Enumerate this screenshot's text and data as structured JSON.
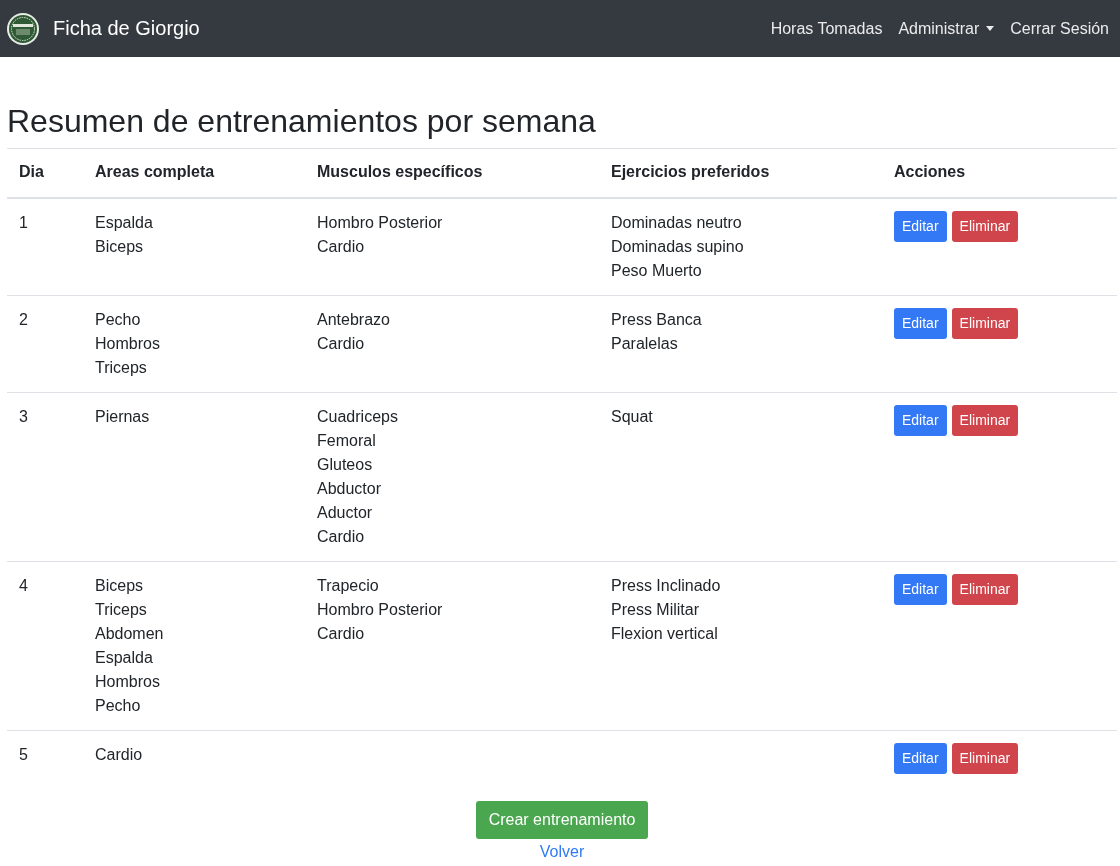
{
  "navbar": {
    "brand": "Ficha de Giorgio",
    "links": [
      {
        "label": "Horas Tomadas",
        "kind": "link"
      },
      {
        "label": "Administrar",
        "kind": "dropdown"
      },
      {
        "label": "Cerrar Sesión",
        "kind": "link"
      }
    ]
  },
  "title": "Resumen de entrenamientos por semana",
  "table": {
    "columns": [
      "Dia",
      "Areas completa",
      "Musculos específicos",
      "Ejercicios preferidos",
      "Acciones"
    ],
    "rows": [
      {
        "dia": "1",
        "areas": [
          "Espalda",
          "Biceps"
        ],
        "musculos": [
          "Hombro Posterior",
          "Cardio"
        ],
        "ejercicios": [
          "Dominadas neutro",
          "Dominadas supino",
          "Peso Muerto"
        ],
        "actions": [
          "Editar",
          "Eliminar"
        ]
      },
      {
        "dia": "2",
        "areas": [
          "Pecho",
          "Hombros",
          "Triceps"
        ],
        "musculos": [
          "Antebrazo",
          "Cardio"
        ],
        "ejercicios": [
          "Press Banca",
          "Paralelas"
        ],
        "actions": [
          "Editar",
          "Eliminar"
        ]
      },
      {
        "dia": "3",
        "areas": [
          "Piernas"
        ],
        "musculos": [
          "Cuadriceps",
          "Femoral",
          "Gluteos",
          "Abductor",
          "Aductor",
          "Cardio"
        ],
        "ejercicios": [
          "Squat"
        ],
        "actions": [
          "Editar",
          "Eliminar"
        ]
      },
      {
        "dia": "4",
        "areas": [
          "Biceps",
          "Triceps",
          "Abdomen",
          "Espalda",
          "Hombros",
          "Pecho"
        ],
        "musculos": [
          "Trapecio",
          "Hombro Posterior",
          "Cardio"
        ],
        "ejercicios": [
          "Press Inclinado",
          "Press Militar",
          "Flexion vertical"
        ],
        "actions": [
          "Editar",
          "Eliminar"
        ]
      },
      {
        "dia": "5",
        "areas": [
          "Cardio"
        ],
        "musculos": [],
        "ejercicios": [],
        "actions": [
          "Editar",
          "Eliminar"
        ]
      }
    ]
  },
  "create_button": "Crear entrenamiento",
  "back_link": "Volver"
}
